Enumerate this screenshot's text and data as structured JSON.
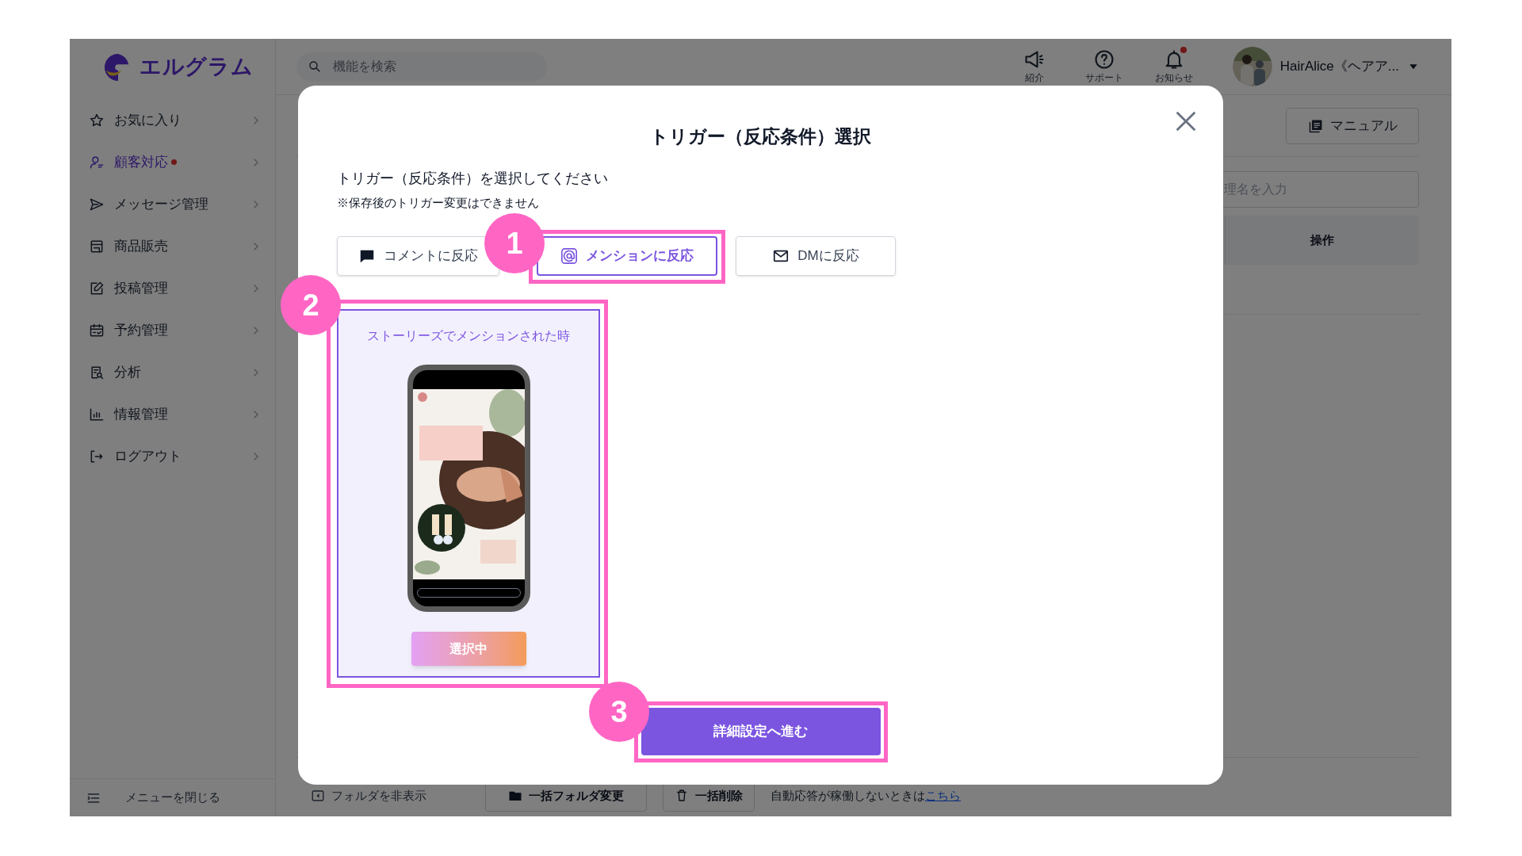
{
  "header": {
    "logo": "エルグラム",
    "search": {
      "placeholder": "機能を検索"
    },
    "icons": [
      {
        "label": "紹介",
        "alert": false
      },
      {
        "label": "サポート",
        "alert": false
      },
      {
        "label": "お知らせ",
        "alert": true
      }
    ],
    "user": {
      "name": "HairAlice《ヘアア..."
    }
  },
  "sidebar": {
    "items": [
      {
        "label": "お気に入り",
        "selected": false,
        "alert": false
      },
      {
        "label": "顧客対応",
        "selected": true,
        "alert": true
      },
      {
        "label": "メッセージ管理",
        "selected": false,
        "alert": false
      },
      {
        "label": "商品販売",
        "selected": false,
        "alert": false
      },
      {
        "label": "投稿管理",
        "selected": false,
        "alert": false
      },
      {
        "label": "予約管理",
        "selected": false,
        "alert": false
      },
      {
        "label": "分析",
        "selected": false,
        "alert": false
      },
      {
        "label": "情報管理",
        "selected": false,
        "alert": false
      },
      {
        "label": "ログアウト",
        "selected": false,
        "alert": false
      }
    ],
    "footer": "メニューを閉じる"
  },
  "page": {
    "manual_button": "マニュアル",
    "filter": {
      "placeholder": "理名を入力"
    },
    "table": {
      "columns": [
        "操作"
      ]
    },
    "toolbar": {
      "hide_folders": "フォルダを非表示",
      "bulk_folder": "一括フォルダ変更",
      "bulk_delete": "一括削除",
      "help_text": "自動応答が稼働しないときは",
      "help_link": "こちら"
    }
  },
  "modal": {
    "title": "トリガー（反応条件）選択",
    "instruction": "トリガー（反応条件）を選択してください",
    "note": "※保存後のトリガー変更はできません",
    "tabs": [
      {
        "label": "コメントに反応",
        "selected": false
      },
      {
        "label": "メンションに反応",
        "selected": true
      },
      {
        "label": "DMに反応",
        "selected": false
      }
    ],
    "cards": [
      {
        "title": "ストーリーズでメンションされた時",
        "button": "選択中",
        "selected": true
      }
    ],
    "next_button": "詳細設定へ進む"
  },
  "callouts": [
    {
      "number": "1"
    },
    {
      "number": "2"
    },
    {
      "number": "3"
    }
  ]
}
